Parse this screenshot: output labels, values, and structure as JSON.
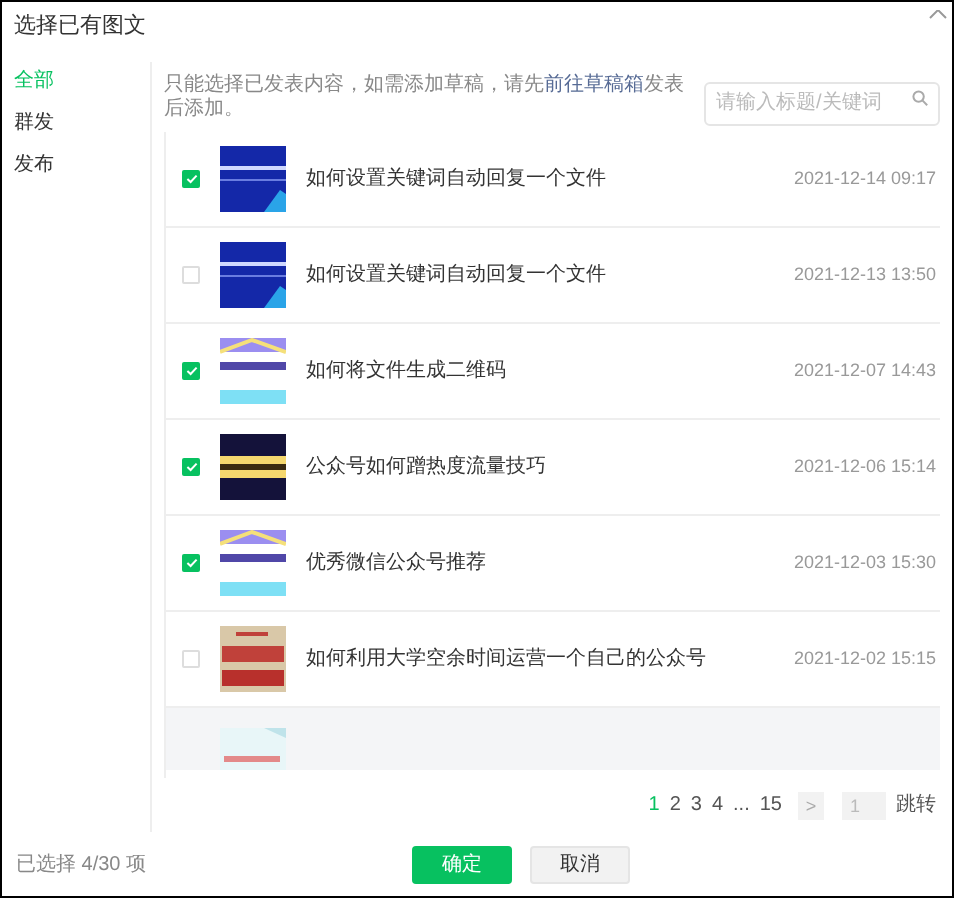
{
  "dialog": {
    "title": "选择已有图文"
  },
  "sidebar": {
    "items": [
      {
        "label": "全部",
        "selected": true
      },
      {
        "label": "群发",
        "selected": false
      },
      {
        "label": "发布",
        "selected": false
      }
    ]
  },
  "notice": {
    "before": "只能选择已发表内容，如需添加草稿，请先",
    "link": "前往草稿箱",
    "after": "发表后添加。"
  },
  "search": {
    "placeholder": "请输入标题/关键词"
  },
  "rows": [
    {
      "checked": true,
      "title": "如何设置关键词自动回复一个文件",
      "date": "2021-12-14 09:17"
    },
    {
      "checked": false,
      "title": "如何设置关键词自动回复一个文件",
      "date": "2021-12-13 13:50"
    },
    {
      "checked": true,
      "title": "如何将文件生成二维码",
      "date": "2021-12-07 14:43"
    },
    {
      "checked": true,
      "title": "公众号如何蹭热度流量技巧",
      "date": "2021-12-06 15:14"
    },
    {
      "checked": true,
      "title": "优秀微信公众号推荐",
      "date": "2021-12-03 15:30"
    },
    {
      "checked": false,
      "title": "如何利用大学空余时间运营一个自己的公众号",
      "date": "2021-12-02 15:15"
    }
  ],
  "pagination": {
    "pages": [
      {
        "label": "1",
        "selected": true
      },
      {
        "label": "2",
        "selected": false
      },
      {
        "label": "3",
        "selected": false
      },
      {
        "label": "4",
        "selected": false
      },
      {
        "label": "...",
        "selected": false
      },
      {
        "label": "15",
        "selected": false
      }
    ],
    "next": ">",
    "jump_value": "1",
    "jump_label": "跳转"
  },
  "footer": {
    "selection": "已选择 4/30 项",
    "confirm": "确定",
    "cancel": "取消"
  }
}
